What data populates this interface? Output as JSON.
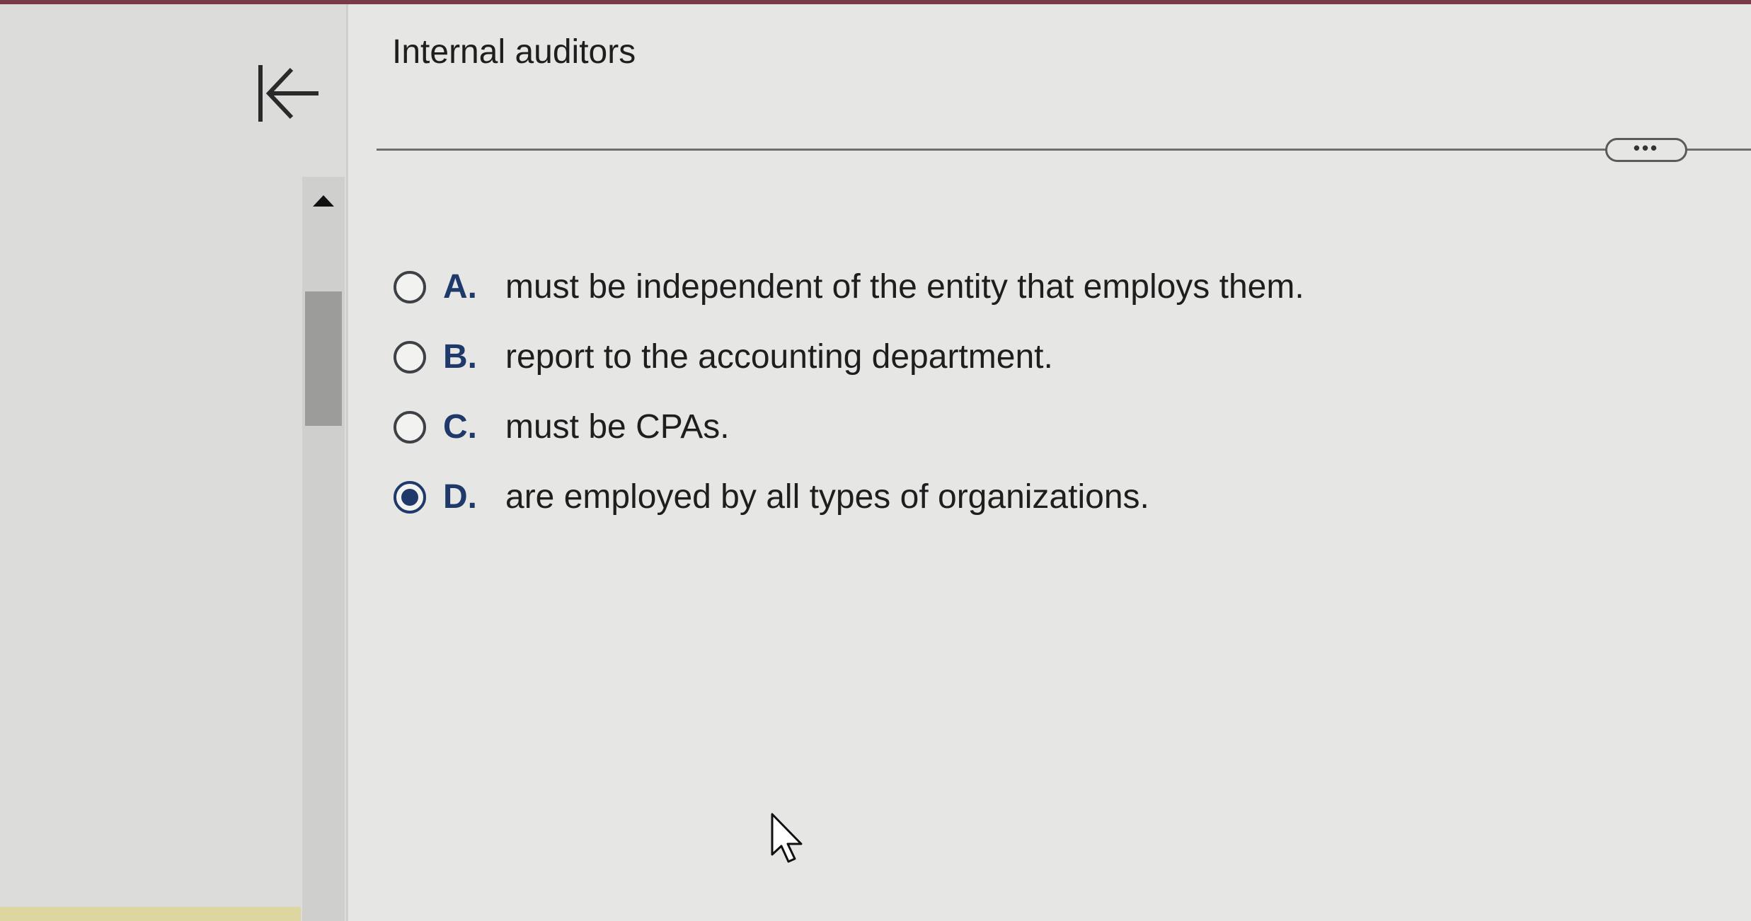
{
  "question": {
    "title": "Internal auditors"
  },
  "options": [
    {
      "letter": "A.",
      "text": "must be independent of the entity that employs them.",
      "selected": false
    },
    {
      "letter": "B.",
      "text": "report to the accounting department.",
      "selected": false
    },
    {
      "letter": "C.",
      "text": "must be CPAs.",
      "selected": false
    },
    {
      "letter": "D.",
      "text": "are employed by all types of organizations.",
      "selected": true
    }
  ],
  "toolbar": {
    "more_label": "•••"
  },
  "icons": {
    "collapse": "collapse-left-icon",
    "scroll_up": "triangle-up-icon",
    "cursor": "mouse-pointer-icon"
  },
  "colors": {
    "accent": "#1f3a6a",
    "top_strip": "#7a3a46"
  }
}
